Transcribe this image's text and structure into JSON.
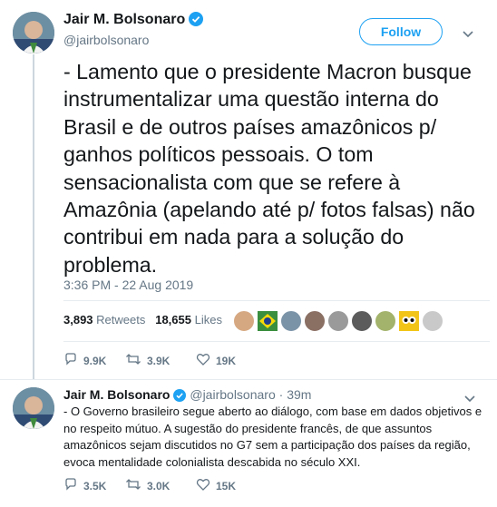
{
  "tweet": {
    "author_name": "Jair M. Bolsonaro",
    "author_handle": "@jairbolsonaro",
    "follow_label": "Follow",
    "text": "- Lamento que o presidente Macron busque instrumentalizar uma questão interna do Brasil e de outros países amazônicos p/ ganhos políticos pessoais. O tom sensacionalista com que se refere à Amazônia (apelando até p/ fotos falsas) não contribui em nada para a solução do problema.",
    "timestamp": "3:36 PM - 22 Aug 2019",
    "retweets_count": "3,893",
    "retweets_label": "Retweets",
    "likes_count": "18,655",
    "likes_label": "Likes",
    "replies": "9.9K",
    "retweets_short": "3.9K",
    "likes_short": "19K"
  },
  "reply": {
    "author_name": "Jair M. Bolsonaro",
    "author_handle": "@jairbolsonaro",
    "separator": "·",
    "time": "39m",
    "text": "- O Governo brasileiro segue aberto ao diálogo, com base em dados objetivos e no respeito mútuo. A sugestão do presidente francês, de que assuntos amazônicos sejam discutidos no G7 sem a participação dos países da região, evoca mentalidade colonialista descabida no século XXI.",
    "replies": "3.5K",
    "retweets": "3.0K",
    "likes": "15K"
  },
  "icons": {
    "reply": "reply-icon",
    "retweet": "retweet-icon",
    "like": "heart-icon",
    "verified": "verified-badge-icon",
    "caret": "chevron-down-icon"
  },
  "colors": {
    "accent": "#1da1f2",
    "muted": "#657786",
    "text": "#14171a",
    "divider": "#e6ecf0"
  }
}
